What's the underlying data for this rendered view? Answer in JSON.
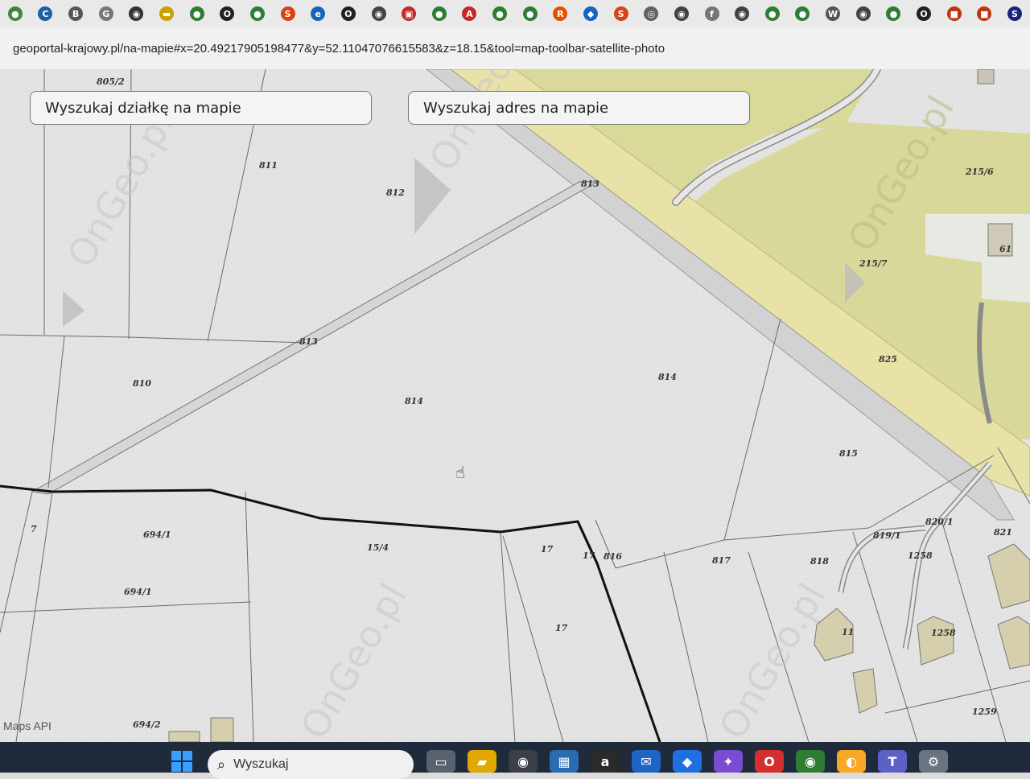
{
  "browser": {
    "url": "geoportal-krajowy.pl/na-mapie#x=20.49217905198477&y=52.11047076615583&z=18.15&tool=map-toolbar-satellite-photo",
    "bookmarks": [
      {
        "name": "bookmark-1",
        "color": "#3a8a3a",
        "glyph": "●"
      },
      {
        "name": "bookmark-2",
        "color": "#1b5fa8",
        "glyph": "C"
      },
      {
        "name": "bookmark-3",
        "color": "#555555",
        "glyph": "B"
      },
      {
        "name": "bookmark-4",
        "color": "#777777",
        "glyph": "G"
      },
      {
        "name": "bookmark-5",
        "color": "#333333",
        "glyph": "◉"
      },
      {
        "name": "bookmark-6",
        "color": "#c8a000",
        "glyph": "▬"
      },
      {
        "name": "bookmark-7",
        "color": "#2e7d32",
        "glyph": "●"
      },
      {
        "name": "bookmark-8",
        "color": "#222222",
        "glyph": "O"
      },
      {
        "name": "bookmark-9",
        "color": "#2e7d32",
        "glyph": "●"
      },
      {
        "name": "bookmark-10",
        "color": "#d84315",
        "glyph": "S"
      },
      {
        "name": "bookmark-11",
        "color": "#1565c0",
        "glyph": "e"
      },
      {
        "name": "bookmark-12",
        "color": "#222222",
        "glyph": "O"
      },
      {
        "name": "bookmark-13",
        "color": "#424242",
        "glyph": "◉"
      },
      {
        "name": "bookmark-14",
        "color": "#c62828",
        "glyph": "▣"
      },
      {
        "name": "bookmark-15",
        "color": "#2e7d32",
        "glyph": "●"
      },
      {
        "name": "bookmark-16",
        "color": "#c62828",
        "glyph": "A"
      },
      {
        "name": "bookmark-17",
        "color": "#2e7d32",
        "glyph": "●"
      },
      {
        "name": "bookmark-18",
        "color": "#2e7d32",
        "glyph": "●"
      },
      {
        "name": "bookmark-19",
        "color": "#e65100",
        "glyph": "R"
      },
      {
        "name": "bookmark-20",
        "color": "#1565c0",
        "glyph": "◆"
      },
      {
        "name": "bookmark-21",
        "color": "#d84315",
        "glyph": "S"
      },
      {
        "name": "bookmark-22",
        "color": "#616161",
        "glyph": "◎"
      },
      {
        "name": "bookmark-23",
        "color": "#424242",
        "glyph": "◉"
      },
      {
        "name": "bookmark-24",
        "color": "#757575",
        "glyph": "f"
      },
      {
        "name": "bookmark-25",
        "color": "#424242",
        "glyph": "◉"
      },
      {
        "name": "bookmark-26",
        "color": "#2e7d32",
        "glyph": "●"
      },
      {
        "name": "bookmark-27",
        "color": "#2e7d32",
        "glyph": "●"
      },
      {
        "name": "bookmark-28",
        "color": "#555555",
        "glyph": "W"
      },
      {
        "name": "bookmark-29",
        "color": "#424242",
        "glyph": "◉"
      },
      {
        "name": "bookmark-30",
        "color": "#2e7d32",
        "glyph": "●"
      },
      {
        "name": "bookmark-31",
        "color": "#222222",
        "glyph": "O"
      },
      {
        "name": "bookmark-32",
        "color": "#bf360c",
        "glyph": "■"
      },
      {
        "name": "bookmark-33",
        "color": "#bf360c",
        "glyph": "■"
      },
      {
        "name": "bookmark-34",
        "color": "#1a237e",
        "glyph": "S"
      }
    ]
  },
  "map": {
    "search_parcel_label": "Wyszukaj działkę na mapie",
    "search_address_label": "Wyszukaj adres na mapie",
    "attribution": "Maps API",
    "watermark": "OnGeo.pl",
    "parcel_labels": {
      "p805_2": "805/2",
      "p811": "811",
      "p812": "812",
      "p813a": "813",
      "p813b": "813",
      "p810": "810",
      "p814a": "814",
      "p814b": "814",
      "p825": "825",
      "p815": "815",
      "p215_6": "215/6",
      "p215_7": "215/7",
      "p61": "61",
      "p7": "7",
      "p694_1a": "694/1",
      "p694_1b": "694/1",
      "p694_2": "694/2",
      "p15_4": "15/4",
      "p17a": "17",
      "p17b": "17",
      "p17c": "17",
      "p816": "816",
      "p817": "817",
      "p818": "818",
      "p819_1": "819/1",
      "p820_1": "820/1",
      "p821": "821",
      "p1258a": "1258",
      "p1258b": "1258",
      "p11": "11",
      "p1259": "1259"
    }
  },
  "taskbar": {
    "search_placeholder": "Wyszukaj",
    "apps": [
      {
        "name": "task-view-icon",
        "color": "#5a6270",
        "glyph": "▭"
      },
      {
        "name": "file-explorer-icon",
        "color": "#e0a800",
        "glyph": "▰"
      },
      {
        "name": "camera-icon",
        "color": "#3a3f48",
        "glyph": "◉"
      },
      {
        "name": "store-icon",
        "color": "#2b6cb0",
        "glyph": "▦"
      },
      {
        "name": "amazon-icon",
        "color": "#2a2a2a",
        "glyph": "a"
      },
      {
        "name": "mail-icon",
        "color": "#1e63c6",
        "glyph": "✉"
      },
      {
        "name": "dropbox-icon",
        "color": "#1f6fe0",
        "glyph": "◆"
      },
      {
        "name": "copilot-icon",
        "color": "#7a4ccf",
        "glyph": "✦"
      },
      {
        "name": "opera-icon",
        "color": "#d32f2f",
        "glyph": "O"
      },
      {
        "name": "chrome-icon",
        "color": "#2e7d32",
        "glyph": "◉"
      },
      {
        "name": "vpn-icon",
        "color": "#f9a825",
        "glyph": "◐"
      },
      {
        "name": "teams-icon",
        "color": "#5c5fc4",
        "glyph": "T"
      },
      {
        "name": "settings-icon",
        "color": "#6b7380",
        "glyph": "⚙"
      }
    ]
  }
}
